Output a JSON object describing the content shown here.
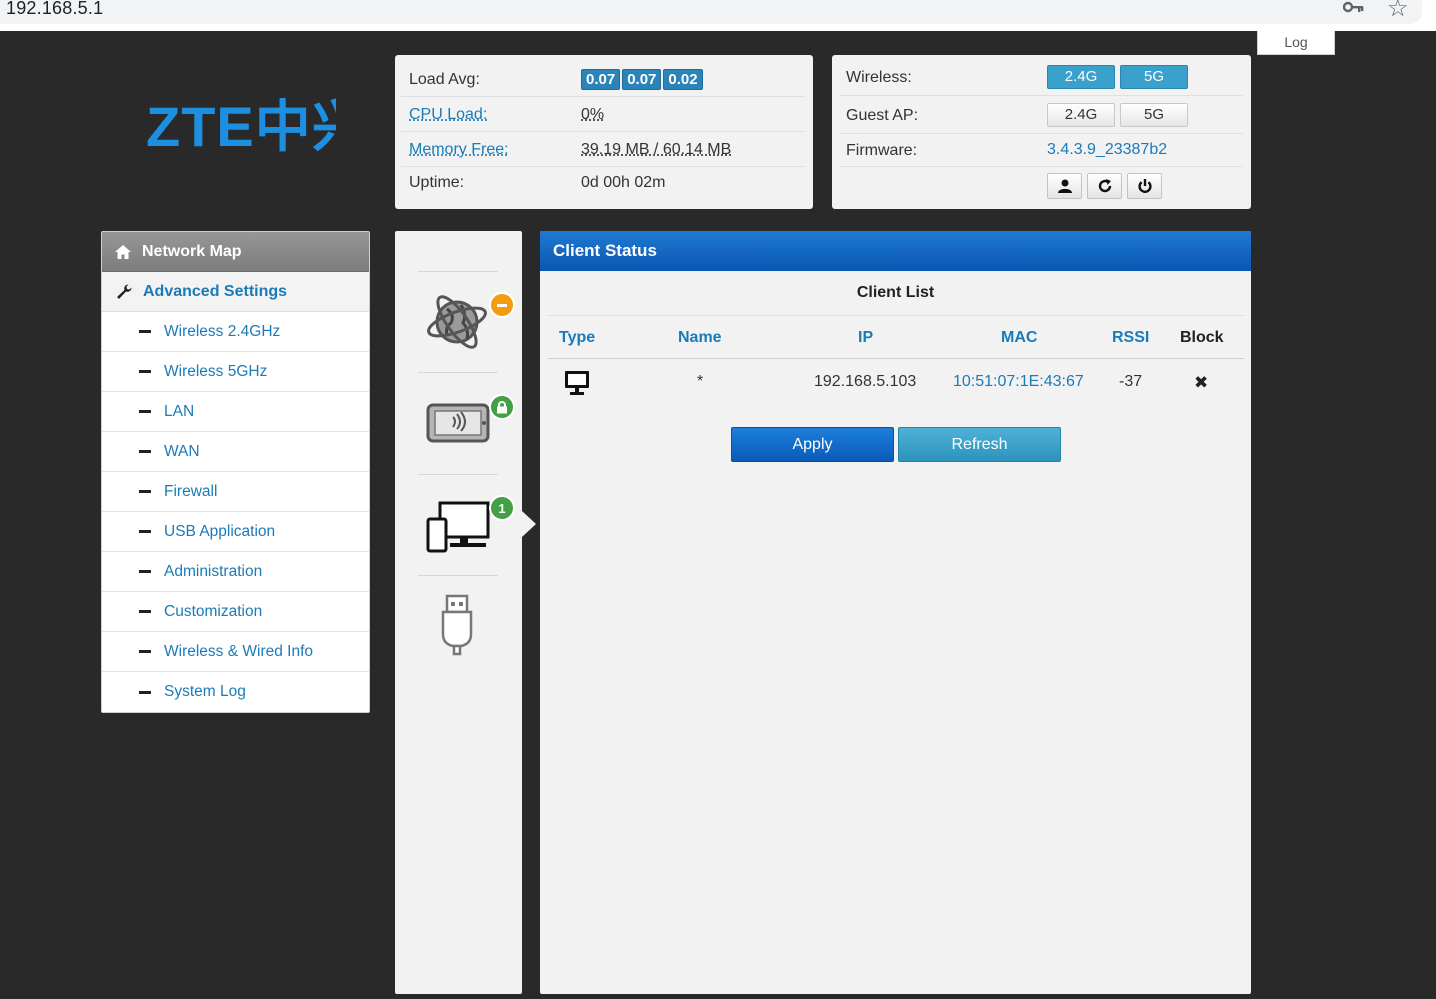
{
  "browser": {
    "url": "192.168.5.1"
  },
  "header": {
    "log_label": "Log"
  },
  "brand": {
    "logo_text": "ZTE中兴"
  },
  "status": {
    "load_avg_label": "Load Avg:",
    "load_avg": [
      "0.07",
      "0.07",
      "0.02"
    ],
    "cpu_label": "CPU Load:",
    "cpu_value": "0%",
    "memory_label": "Memory Free:",
    "memory_value": "39.19 MB / 60.14 MB",
    "uptime_label": "Uptime:",
    "uptime_value": "0d 00h 02m"
  },
  "wireless_panel": {
    "wireless_label": "Wireless:",
    "wireless_24": "2.4G",
    "wireless_5": "5G",
    "guest_label": "Guest AP:",
    "guest_24": "2.4G",
    "guest_5": "5G",
    "firmware_label": "Firmware:",
    "firmware_value": "3.4.3.9_23387b2"
  },
  "menu": {
    "network_map": "Network Map",
    "advanced_settings": "Advanced Settings",
    "items": [
      "Wireless 2.4GHz",
      "Wireless 5GHz",
      "LAN",
      "WAN",
      "Firewall",
      "USB Application",
      "Administration",
      "Customization",
      "Wireless & Wired Info",
      "System Log"
    ]
  },
  "indicators": {
    "clients_count": "1"
  },
  "client_status": {
    "title": "Client Status",
    "subtitle": "Client List",
    "columns": [
      "Type",
      "Name",
      "IP",
      "MAC",
      "RSSI",
      "Block"
    ],
    "rows": [
      {
        "name": "*",
        "ip": "192.168.5.103",
        "mac": "10:51:07:1E:43:67",
        "rssi": "-37",
        "block": "✖"
      }
    ],
    "apply_label": "Apply",
    "refresh_label": "Refresh"
  }
}
